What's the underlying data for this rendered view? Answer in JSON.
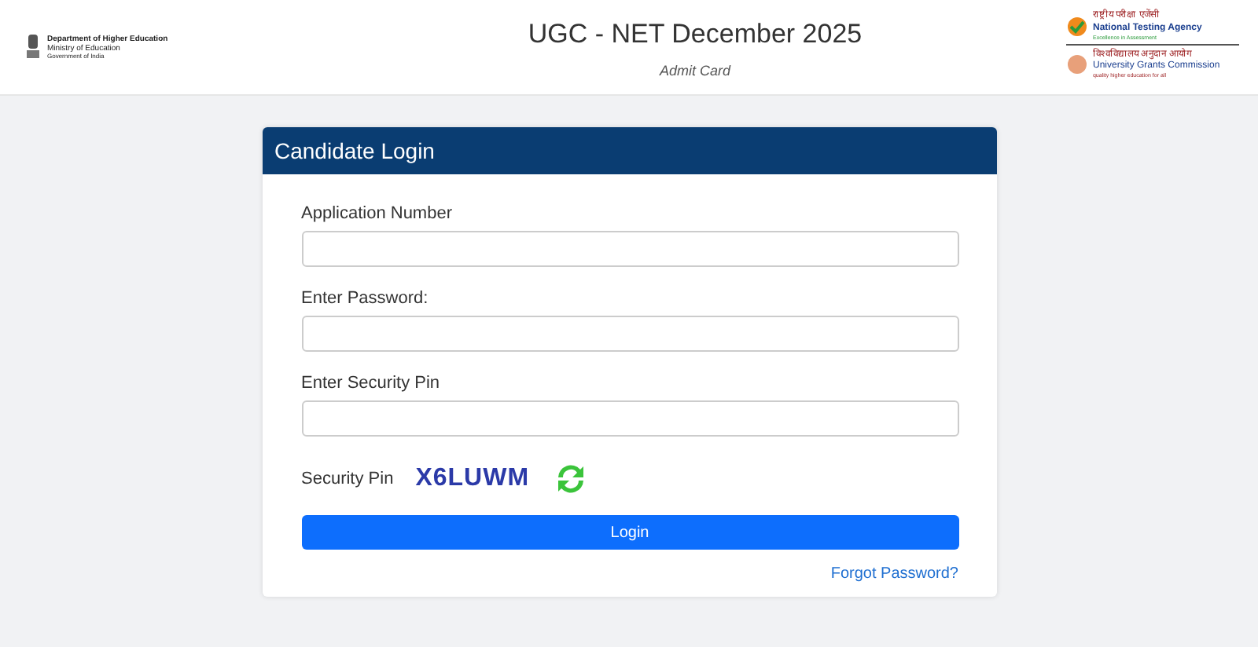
{
  "header": {
    "left_logo": {
      "lines": [
        "Department of Higher Education",
        "Ministry of Education",
        "Government of India"
      ]
    },
    "title": "UGC - NET December 2025",
    "subtitle": "Admit Card",
    "right_logos": [
      {
        "lines": [
          "राष्ट्रीय परीक्षा एजेंसी",
          "National Testing Agency"
        ],
        "tagline": "Excellence in Assessment"
      },
      {
        "lines": [
          "विश्वविद्यालय अनुदान आयोग",
          "University Grants Commission"
        ],
        "tagline": "quality higher education for all"
      }
    ]
  },
  "login": {
    "title": "Candidate Login",
    "fields": [
      {
        "label": "Application Number"
      },
      {
        "label": "Enter Password:"
      },
      {
        "label": "Enter Security Pin"
      }
    ],
    "captcha": {
      "label": "Security Pin",
      "code": "X6LUWM"
    },
    "button": "Login",
    "link": "Forgot Password?"
  }
}
